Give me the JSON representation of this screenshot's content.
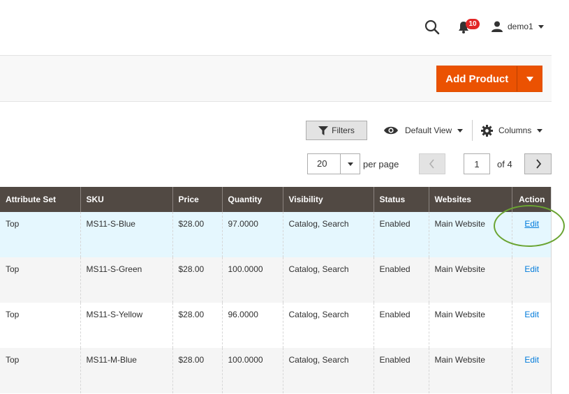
{
  "header": {
    "notifications_count": "10",
    "username": "demo1"
  },
  "actions": {
    "add_product_label": "Add Product"
  },
  "controls": {
    "filters_label": "Filters",
    "view_label": "Default View",
    "columns_label": "Columns",
    "per_page_value": "20",
    "per_page_label": "per page",
    "current_page": "1",
    "of_pages": "of 4"
  },
  "table": {
    "columns": [
      "Attribute Set",
      "SKU",
      "Price",
      "Quantity",
      "Visibility",
      "Status",
      "Websites",
      "Action"
    ],
    "rows": [
      {
        "attribute_set": "Top",
        "sku": "MS11-S-Blue",
        "price": "$28.00",
        "quantity": "97.0000",
        "visibility": "Catalog, Search",
        "status": "Enabled",
        "websites": "Main Website",
        "action": "Edit"
      },
      {
        "attribute_set": "Top",
        "sku": "MS11-S-Green",
        "price": "$28.00",
        "quantity": "100.0000",
        "visibility": "Catalog, Search",
        "status": "Enabled",
        "websites": "Main Website",
        "action": "Edit"
      },
      {
        "attribute_set": "Top",
        "sku": "MS11-S-Yellow",
        "price": "$28.00",
        "quantity": "96.0000",
        "visibility": "Catalog, Search",
        "status": "Enabled",
        "websites": "Main Website",
        "action": "Edit"
      },
      {
        "attribute_set": "Top",
        "sku": "MS11-M-Blue",
        "price": "$28.00",
        "quantity": "100.0000",
        "visibility": "Catalog, Search",
        "status": "Enabled",
        "websites": "Main Website",
        "action": "Edit"
      }
    ]
  },
  "colors": {
    "accent": "#eb5202",
    "table_header": "#514943",
    "link": "#007bdb",
    "active_row": "#e5f7fe",
    "highlight_ring": "#6aa432"
  }
}
